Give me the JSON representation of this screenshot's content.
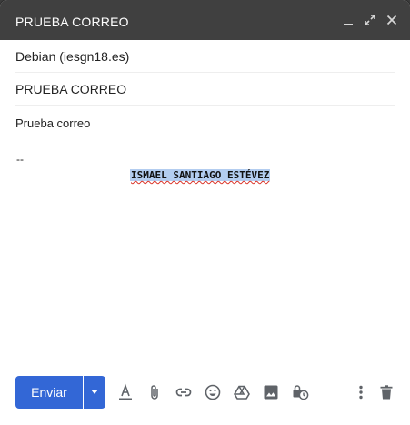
{
  "window": {
    "title": "PRUEBA CORREO",
    "controls": [
      "minimize-icon",
      "expand-icon",
      "close-icon"
    ]
  },
  "recipients": {
    "to": "Debian (iesgn18.es)"
  },
  "subject": {
    "value": "PRUEBA CORREO"
  },
  "message": {
    "body": "Prueba correo",
    "signature_separator": "--",
    "signature_name": "ISMAEL SANTIAGO ESTÉVEZ"
  },
  "toolbar": {
    "send_label": "Enviar",
    "tools": [
      "text-format-icon",
      "attach-icon",
      "link-icon",
      "emoji-icon",
      "drive-icon",
      "image-icon",
      "confidential-icon",
      "more-options-icon",
      "delete-icon"
    ]
  },
  "colors": {
    "titlebar": "#404040",
    "send_button": "#3367d6",
    "selection": "#b3cdf0",
    "icon_gray": "#5f6368"
  }
}
